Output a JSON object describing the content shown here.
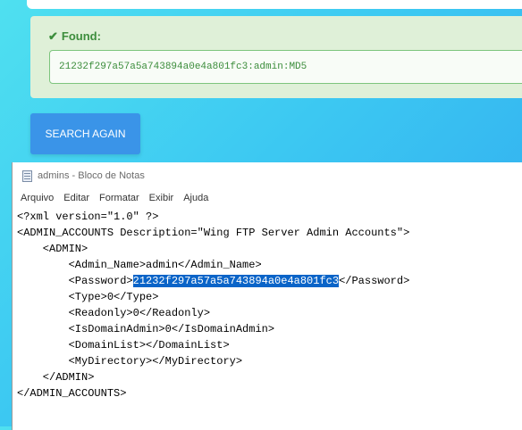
{
  "found": {
    "label": "Found:",
    "value": "21232f297a57a5a743894a0e4a801fc3:admin:MD5"
  },
  "search_again_label": "SEARCH AGAIN",
  "notepad": {
    "title": "admins - Bloco de Notas",
    "menu": [
      "Arquivo",
      "Editar",
      "Formatar",
      "Exibir",
      "Ajuda"
    ],
    "lines": {
      "l1": "<?xml version=\"1.0\" ?>",
      "l2": "<ADMIN_ACCOUNTS Description=\"Wing FTP Server Admin Accounts\">",
      "l3": "    <ADMIN>",
      "l4": "        <Admin_Name>admin</Admin_Name>",
      "l5_prefix": "        <Password>",
      "l5_selected": "21232f297a57a5a743894a0e4a801fc3",
      "l5_suffix": "</Password>",
      "l6": "        <Type>0</Type>",
      "l7": "        <Readonly>0</Readonly>",
      "l8": "        <IsDomainAdmin>0</IsDomainAdmin>",
      "l9": "        <DomainList></DomainList>",
      "l10": "        <MyDirectory></MyDirectory>",
      "l11": "    </ADMIN>",
      "l12": "</ADMIN_ACCOUNTS>"
    }
  }
}
